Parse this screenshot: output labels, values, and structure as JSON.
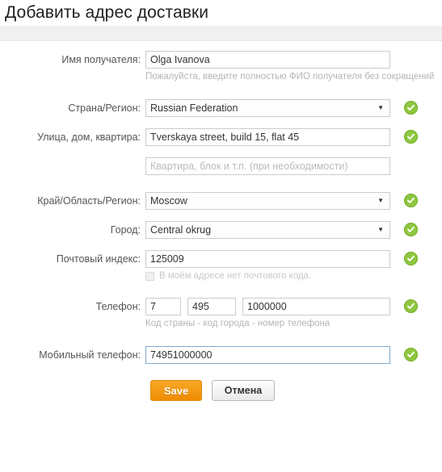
{
  "header": {
    "title": "Добавить адрес доставки"
  },
  "form": {
    "recipient": {
      "label": "Имя получателя:",
      "value": "Olga Ivanova",
      "placeholder": "",
      "hint": "Пожалуйста, введите полностью ФИО получателя без сокращений"
    },
    "country": {
      "label": "Страна/Регион:",
      "value": "Russian Federation",
      "caret": "▼"
    },
    "street": {
      "label": "Улица, дом, квартира:",
      "value": "Tverskaya street, build 15, flat 45",
      "placeholder": ""
    },
    "street2": {
      "value": "",
      "placeholder": "Квартира, блок и т.п. (при необходимости)"
    },
    "region": {
      "label": "Край/Область/Регион:",
      "value": "Moscow",
      "caret": "▼"
    },
    "city": {
      "label": "Город:",
      "value": "Central okrug",
      "caret": "▼"
    },
    "zip": {
      "label": "Почтовый индекс:",
      "value": "125009",
      "placeholder": "",
      "checkbox_label": "В моём адресе нет почтового кода."
    },
    "phone": {
      "label": "Телефон:",
      "country_code": "7",
      "city_code": "495",
      "number": "1000000",
      "hint": "Код страны - код города - номер телефона"
    },
    "mobile": {
      "label": "Мобильный телефон:",
      "value": "74951000000",
      "placeholder": ""
    }
  },
  "buttons": {
    "save": "Save",
    "cancel": "Отмена"
  },
  "colors": {
    "accent_orange": "#f08c00",
    "valid_green": "#8dc63f",
    "focus_blue": "#7fa9cc",
    "label_gray": "#555555",
    "hint_gray": "#b5b5b5"
  }
}
